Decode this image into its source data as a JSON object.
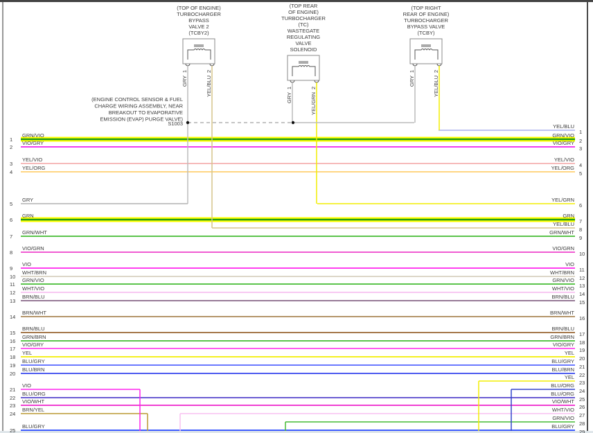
{
  "components": [
    {
      "id": "tcby2",
      "label": [
        "(TOP OF ENGINE)",
        "TURBOCHARGER",
        "BYPASS",
        "VALVE 2",
        "(TCBY2)"
      ],
      "pins": [
        {
          "num": "1",
          "wire": "GRY",
          "color": "#bbbbbb"
        },
        {
          "num": "2",
          "wire": "YEL/BLU",
          "color": "#d6c48a"
        }
      ]
    },
    {
      "id": "tc",
      "label": [
        "(TOP REAR",
        "OF ENGINE)",
        "TURBOCHARGER",
        "(TC)",
        "WASTEGATE",
        "REGULATING",
        "VALVE",
        "SOLENOID"
      ],
      "pins": [
        {
          "num": "1",
          "wire": "GRY",
          "color": "#bbbbbb"
        },
        {
          "num": "2",
          "wire": "YEL/GRN",
          "color": "#f2ee00"
        }
      ]
    },
    {
      "id": "tcby",
      "label": [
        "(TOP RIGHT",
        "REAR OF ENGINE)",
        "TURBOCHARGER",
        "BYPASS VALVE",
        "(TCBY)"
      ],
      "pins": [
        {
          "num": "1",
          "wire": "GRY",
          "color": "#bbbbbb"
        },
        {
          "num": "2",
          "wire": "YEL/BLU",
          "color": "#f2ee00"
        }
      ]
    }
  ],
  "splice": {
    "id": "S1003",
    "label": [
      "(ENGINE CONTROL SENSOR & FUEL",
      "CHARGE WIRING ASSEMBLY, NEAR",
      "BREAKOUT TO EVAPORATIVE",
      "EMISSION (EVAP) PURGE VALVE)"
    ],
    "name": "S1003"
  },
  "left_wires": [
    {
      "num": "1",
      "label": "GRN/VIO",
      "color": "#1a9a1a",
      "tracer": "#ffff00"
    },
    {
      "num": "2",
      "label": "VIO/GRY",
      "color": "#ee22ee"
    },
    {
      "num": "3",
      "label": "YEL/VIO",
      "color": "#f5b0b0"
    },
    {
      "num": "4",
      "label": "YEL/ORG",
      "color": "#ffd070"
    },
    {
      "num": "5",
      "label": "GRY",
      "color": "#bbbbbb"
    },
    {
      "num": "6",
      "label": "GRN",
      "color": "#1a9a1a",
      "tracer": "#ffff00"
    },
    {
      "num": "7",
      "label": "GRN/WHT",
      "color": "#44bb33"
    },
    {
      "num": "8",
      "label": "VIO/GRN",
      "color": "#ee44cc"
    },
    {
      "num": "9",
      "label": "VIO",
      "color": "#ff22ee"
    },
    {
      "num": "10",
      "label": "WHT/BRN",
      "color": "#d8d0c0"
    },
    {
      "num": "11",
      "label": "GRN/VIO",
      "color": "#44bb33"
    },
    {
      "num": "12",
      "label": "WHT/VIO",
      "color": "#f8c0f0"
    },
    {
      "num": "13",
      "label": "BRN/BLU",
      "color": "#886688"
    },
    {
      "num": "14",
      "label": "BRN/WHT",
      "color": "#aa8855"
    },
    {
      "num": "15",
      "label": "BRN/BLU",
      "color": "#996633"
    },
    {
      "num": "16",
      "label": "GRN/BRN",
      "color": "#44bb33"
    },
    {
      "num": "17",
      "label": "VIO/GRY",
      "color": "#ff44ee"
    },
    {
      "num": "18",
      "label": "YEL",
      "color": "#f2ee00"
    },
    {
      "num": "19",
      "label": "BLU/GRY",
      "color": "#5566ff"
    },
    {
      "num": "20",
      "label": "BLU/BRN",
      "color": "#3344ee"
    },
    {
      "num": "21",
      "label": "VIO",
      "color": "#ff22ee"
    },
    {
      "num": "22",
      "label": "BLU/ORG",
      "color": "#5544cc"
    },
    {
      "num": "23",
      "label": "VIO/WHT",
      "color": "#ee22cc"
    },
    {
      "num": "24",
      "label": "BRN/YEL",
      "color": "#bb9933"
    },
    {
      "num": "25",
      "label": "BLU/GRY",
      "color": "#2244ff"
    }
  ],
  "right_wires": [
    {
      "num": "1",
      "label": "YEL/BLU",
      "color": "#aab0ee"
    },
    {
      "num": "2",
      "label": "GRN/VIO",
      "color": "#1a9a1a",
      "tracer": "#ffff00"
    },
    {
      "num": "3",
      "label": "VIO/GRY",
      "color": "#ee22ee"
    },
    {
      "num": "4",
      "label": "YEL/VIO",
      "color": "#f5b0b0"
    },
    {
      "num": "5",
      "label": "YEL/ORG",
      "color": "#ffd070"
    },
    {
      "num": "6",
      "label": "YEL/GRN",
      "color": "#f2ee00"
    },
    {
      "num": "7",
      "label": "GRN",
      "color": "#1a9a1a",
      "tracer": "#ffff00"
    },
    {
      "num": "8",
      "label": "YEL/BLU",
      "color": "#d6c48a"
    },
    {
      "num": "9",
      "label": "GRN/WHT",
      "color": "#44bb33"
    },
    {
      "num": "10",
      "label": "VIO/GRN",
      "color": "#ee44cc"
    },
    {
      "num": "11",
      "label": "VIO",
      "color": "#ff22ee"
    },
    {
      "num": "12",
      "label": "WHT/BRN",
      "color": "#d8d0c0"
    },
    {
      "num": "13",
      "label": "GRN/VIO",
      "color": "#44bb33"
    },
    {
      "num": "14",
      "label": "WHT/VIO",
      "color": "#f8c0f0"
    },
    {
      "num": "15",
      "label": "BRN/BLU",
      "color": "#886688"
    },
    {
      "num": "16",
      "label": "BRN/WHT",
      "color": "#aa8855"
    },
    {
      "num": "17",
      "label": "BRN/BLU",
      "color": "#996633"
    },
    {
      "num": "18",
      "label": "GRN/BRN",
      "color": "#44bb33"
    },
    {
      "num": "19",
      "label": "VIO/GRY",
      "color": "#ff44ee"
    },
    {
      "num": "20",
      "label": "YEL",
      "color": "#f2ee00"
    },
    {
      "num": "21",
      "label": "BLU/GRY",
      "color": "#5566ff"
    },
    {
      "num": "22",
      "label": "BLU/BRN",
      "color": "#3344ee"
    },
    {
      "num": "23",
      "label": "YEL",
      "color": "#f2ee00"
    },
    {
      "num": "24",
      "label": "BLU/ORG",
      "color": "#3344cc"
    },
    {
      "num": "25",
      "label": "BLU/ORG",
      "color": "#5544cc"
    },
    {
      "num": "26",
      "label": "VIO/WHT",
      "color": "#ee22cc"
    },
    {
      "num": "27",
      "label": "WHT/VIO",
      "color": "#f8c0f0"
    },
    {
      "num": "28",
      "label": "GRN/VIO",
      "color": "#44bb33"
    },
    {
      "num": "29",
      "label": "BLU/GRY",
      "color": "#2244ff"
    }
  ]
}
